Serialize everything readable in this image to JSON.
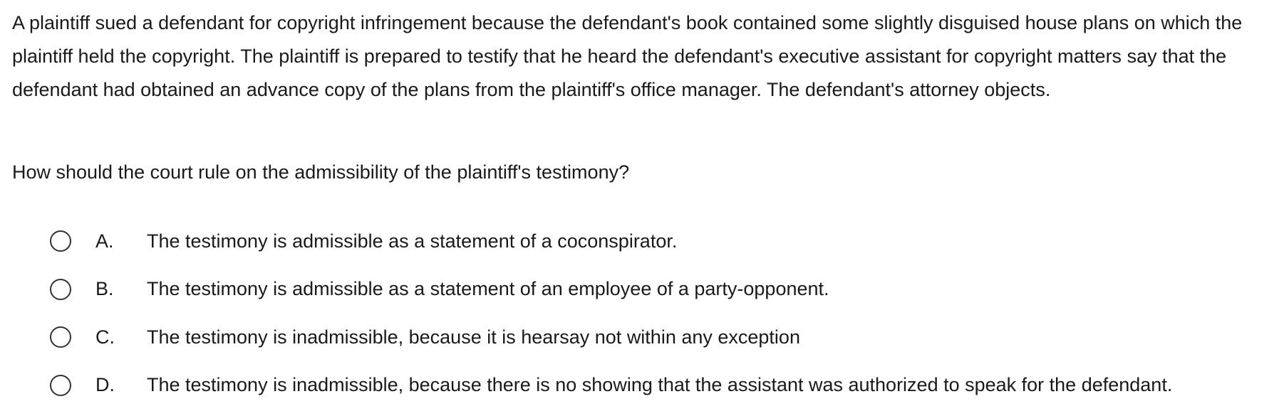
{
  "question": {
    "stem": "A plaintiff sued a defendant for copyright infringement because the defendant's book contained some slightly disguised house plans on which the plaintiff held the copyright.  The plaintiff is prepared to testify that he heard the defendant's executive assistant for copyright matters say that the defendant had obtained an advance copy of the plans from the plaintiff's office manager.  The defendant's attorney objects.",
    "prompt": "How should the court rule on the admissibility of the plaintiff's testimony?"
  },
  "options": [
    {
      "letter": "A.",
      "text": "The testimony is admissible as a statement of a coconspirator."
    },
    {
      "letter": "B.",
      "text": "The testimony is admissible as a statement of an employee of a party-opponent."
    },
    {
      "letter": "C.",
      "text": "The testimony is inadmissible, because it is hearsay not within any exception"
    },
    {
      "letter": "D.",
      "text": "The testimony is inadmissible, because there is no showing that the assistant was authorized to speak for the defendant."
    }
  ]
}
